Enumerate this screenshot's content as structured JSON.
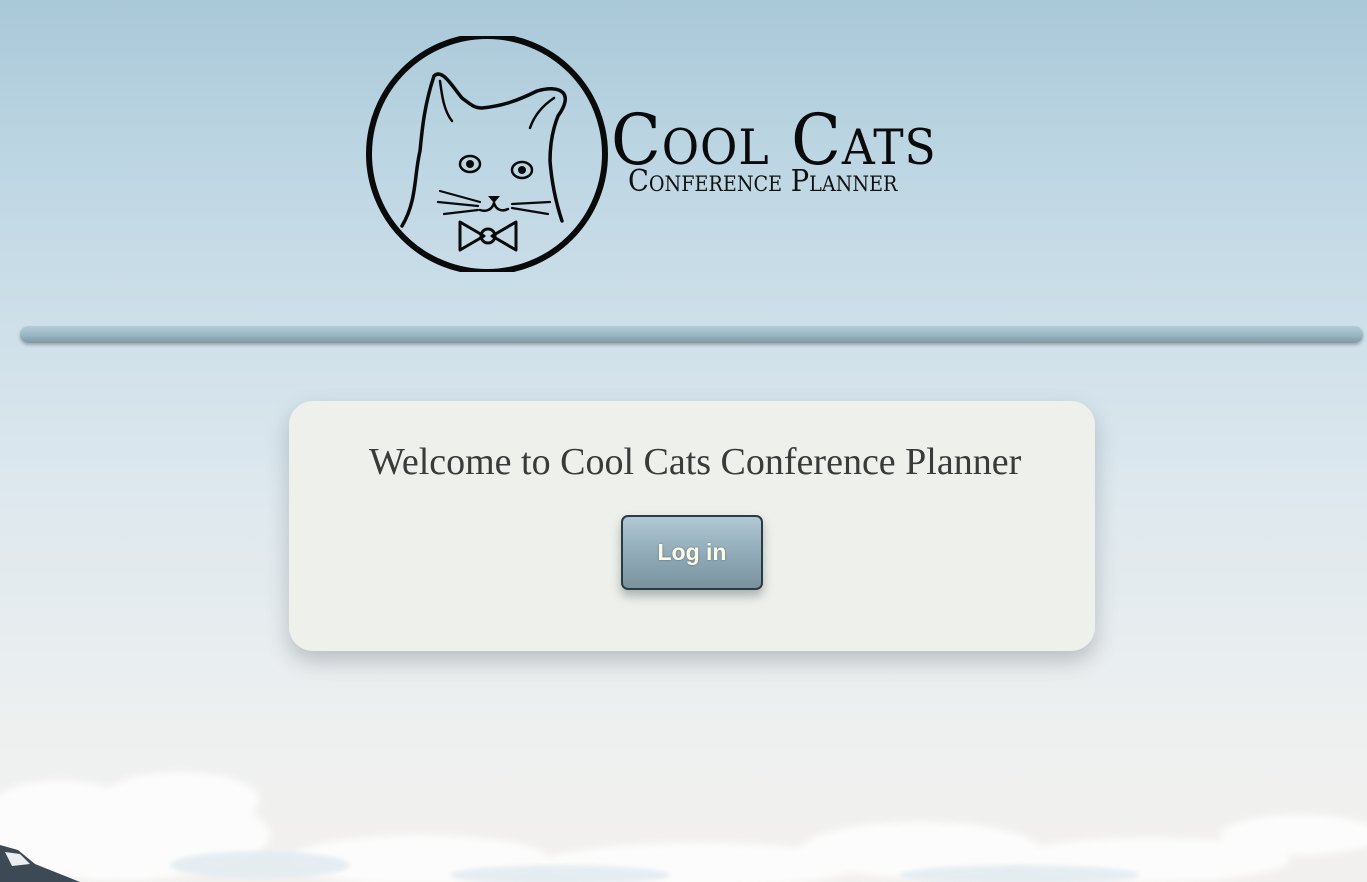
{
  "brand": {
    "title": "Cool Cats",
    "subtitle": "Conference Planner"
  },
  "card": {
    "welcome_text": "Welcome to Cool Cats Conference Planner",
    "login_label": "Log in"
  },
  "colors": {
    "card_background": "#eef0eb",
    "button_gradient_top": "#b0c8d4",
    "button_gradient_bottom": "#7a929e",
    "button_text": "#fdfbe6",
    "divider": "#9cb8c6"
  },
  "icons": {
    "logo": "cat-with-bowtie-logo"
  }
}
